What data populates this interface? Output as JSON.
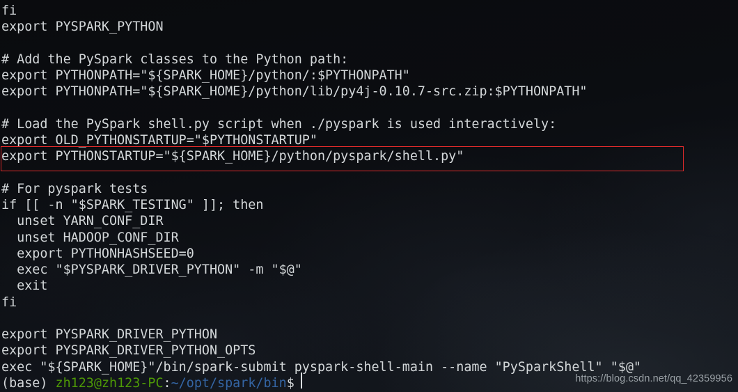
{
  "terminal": {
    "type": "terminal-window",
    "background_color": "#0d0f12",
    "foreground_color": "#d3d7d9",
    "font_size_px": 18.4,
    "line_height_px": 23.25,
    "lines": [
      "fi",
      "export PYSPARK_PYTHON",
      "",
      "# Add the PySpark classes to the Python path:",
      "export PYTHONPATH=\"${SPARK_HOME}/python/:$PYTHONPATH\"",
      "export PYTHONPATH=\"${SPARK_HOME}/python/lib/py4j-0.10.7-src.zip:$PYTHONPATH\"",
      "",
      "# Load the PySpark shell.py script when ./pyspark is used interactively:",
      "export OLD_PYTHONSTARTUP=\"$PYTHONSTARTUP\"",
      "export PYTHONSTARTUP=\"${SPARK_HOME}/python/pyspark/shell.py\"",
      "",
      "# For pyspark tests",
      "if [[ -n \"$SPARK_TESTING\" ]]; then",
      "  unset YARN_CONF_DIR",
      "  unset HADOOP_CONF_DIR",
      "  export PYTHONHASHSEED=0",
      "  exec \"$PYSPARK_DRIVER_PYTHON\" -m \"$@\"",
      "  exit",
      "fi",
      "",
      "export PYSPARK_DRIVER_PYTHON",
      "export PYSPARK_DRIVER_PYTHON_OPTS",
      "exec \"${SPARK_HOME}\"/bin/spark-submit pyspark-shell-main --name \"PySparkShell\" \"$@\""
    ]
  },
  "highlight": {
    "label": "red-annotation-rectangle",
    "target_line": "export PYTHONSTARTUP=\"${SPARK_HOME}/python/pyspark/shell.py\"",
    "border_color": "#e02b2b"
  },
  "prompt": {
    "env": "(base) ",
    "user_host": "zh123@zh123-PC",
    "separator": ":",
    "path": "~/opt/spark/bin",
    "symbol": "$ ",
    "user_host_color": "#4e9a06",
    "path_color": "#3465a4",
    "cursor": "|"
  },
  "watermark": {
    "text": "https://blog.csdn.net/qq_42359956",
    "color": "#9aa1a6"
  }
}
